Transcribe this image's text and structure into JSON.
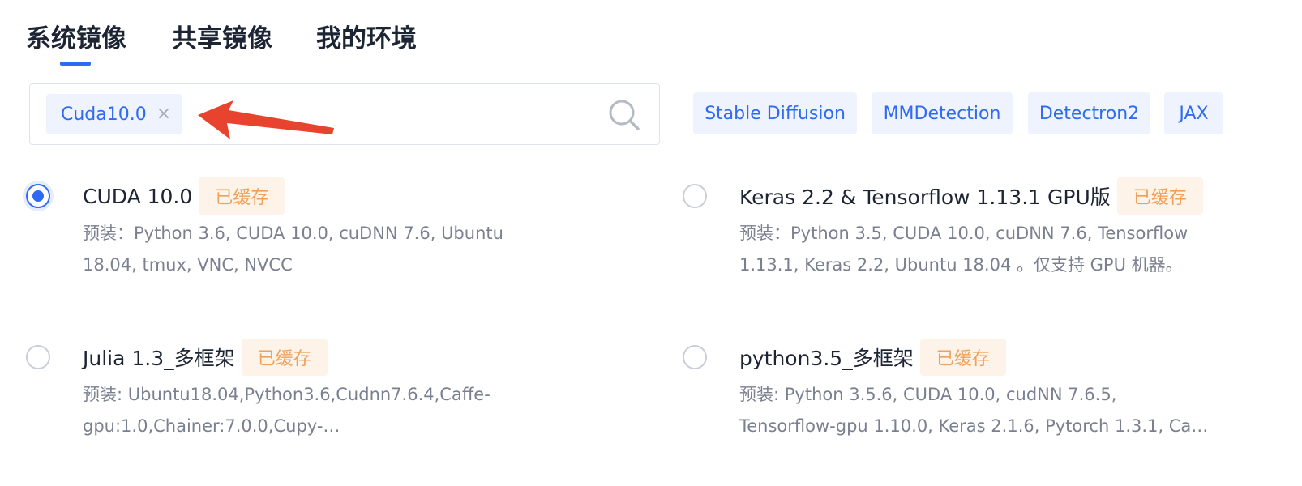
{
  "tabs": [
    {
      "label": "系统镜像",
      "active": true
    },
    {
      "label": "共享镜像",
      "active": false
    },
    {
      "label": "我的环境",
      "active": false
    }
  ],
  "search": {
    "tag": "Cuda10.0",
    "tag_close": "×"
  },
  "quick_tags": [
    "Stable Diffusion",
    "MMDetection",
    "Detectron2",
    "JAX"
  ],
  "colors": {
    "accent": "#2f6bf2",
    "badge_bg": "#fdf3e8",
    "badge_text": "#f0a05a",
    "arrow": "#e8432e"
  },
  "images": [
    {
      "title": "CUDA 10.0",
      "badge": "已缓存",
      "selected": true,
      "desc_line1": "预装：Python 3.6, CUDA 10.0, cuDNN 7.6, Ubuntu",
      "desc_line2": "18.04, tmux, VNC, NVCC"
    },
    {
      "title": "Keras 2.2 & Tensorflow 1.13.1 GPU版",
      "badge": "已缓存",
      "selected": false,
      "desc_line1": "预装：Python 3.5, CUDA 10.0, cuDNN 7.6, Tensorflow",
      "desc_line2": "1.13.1, Keras 2.2, Ubuntu 18.04 。仅支持 GPU 机器。"
    },
    {
      "title": "Julia 1.3_多框架",
      "badge": "已缓存",
      "selected": false,
      "desc_line1": "预装: Ubuntu18.04,Python3.6,Cudnn7.6.4,Caffe-",
      "desc_line2": "gpu:1.0,Chainer:7.0.0,Cupy-…"
    },
    {
      "title": "python3.5_多框架",
      "badge": "已缓存",
      "selected": false,
      "desc_line1": "预装: Python 3.5.6, CUDA 10.0, cudNN 7.6.5,",
      "desc_line2": "Tensorflow-gpu 1.10.0, Keras 2.1.6, Pytorch 1.3.1, Ca…"
    }
  ]
}
